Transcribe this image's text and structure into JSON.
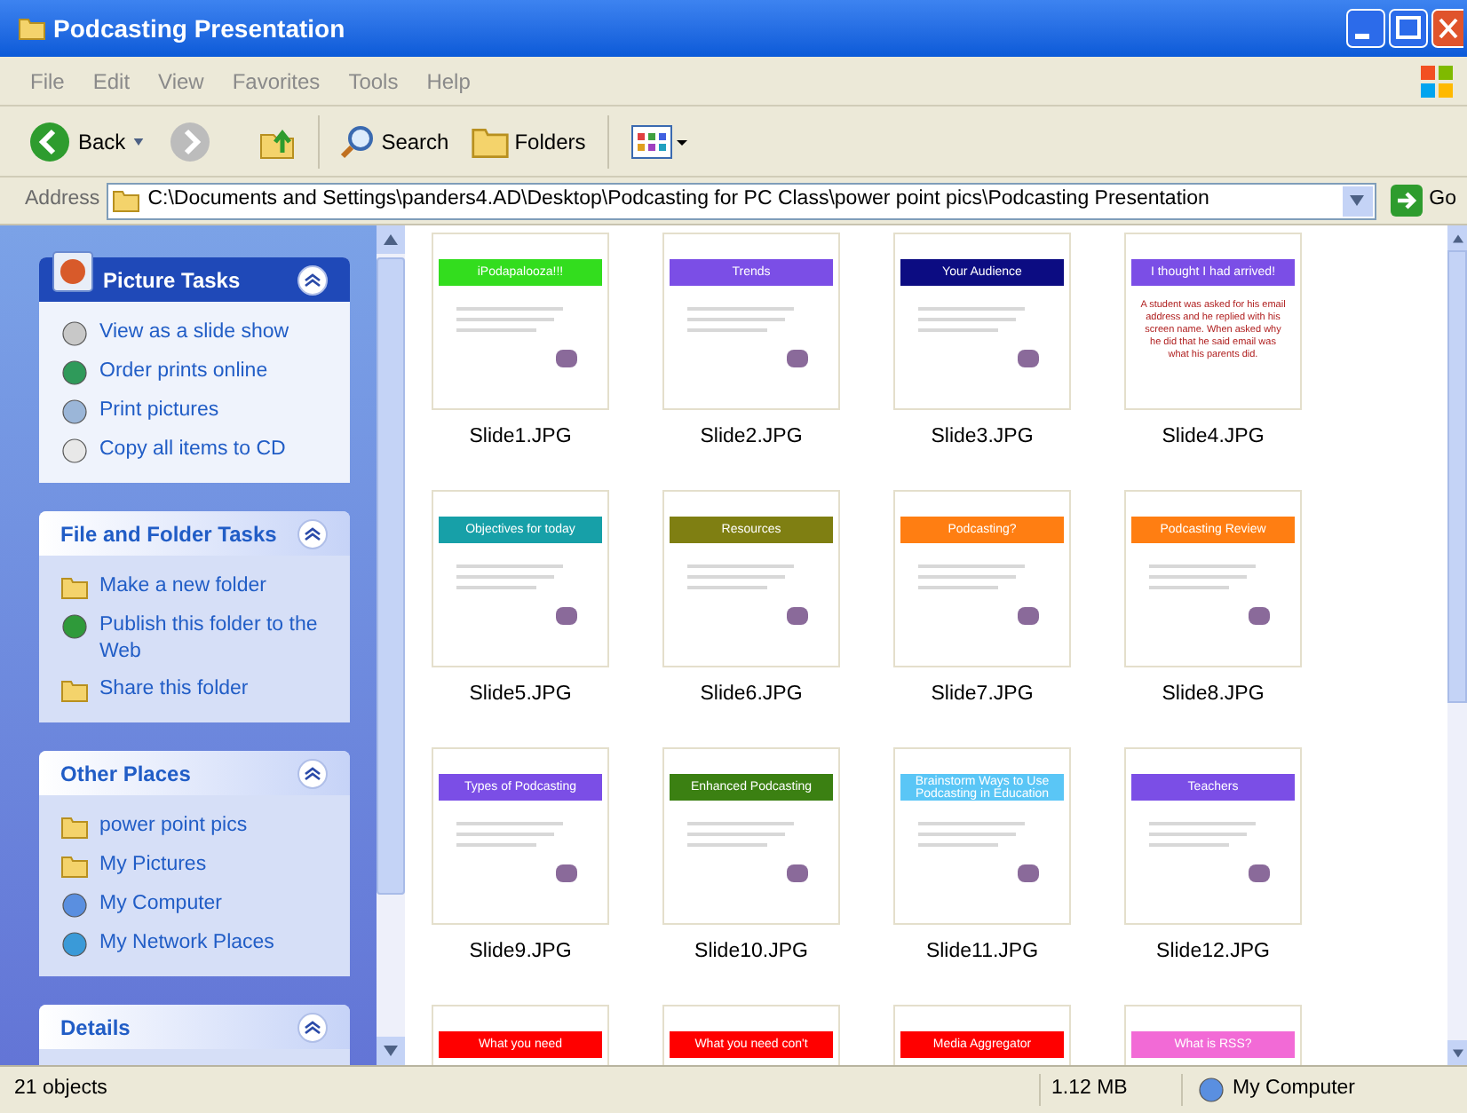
{
  "window": {
    "title": "Podcasting Presentation"
  },
  "menu": [
    "File",
    "Edit",
    "View",
    "Favorites",
    "Tools",
    "Help"
  ],
  "toolbar": {
    "back": "Back",
    "search": "Search",
    "folders": "Folders"
  },
  "address": {
    "label": "Address",
    "value": "C:\\Documents and Settings\\panders4.AD\\Desktop\\Podcasting for PC Class\\power point pics\\Podcasting Presentation",
    "go": "Go"
  },
  "task_panels": [
    {
      "title": "Picture Tasks",
      "kind": "special",
      "expanded": true,
      "items": [
        "View as a slide show",
        "Order prints online",
        "Print pictures",
        "Copy all items to CD"
      ]
    },
    {
      "title": "File and Folder Tasks",
      "kind": "normal",
      "expanded": true,
      "items": [
        "Make a new folder",
        "Publish this folder to the Web",
        "Share this folder"
      ]
    },
    {
      "title": "Other Places",
      "kind": "normal",
      "expanded": true,
      "items": [
        "power point pics",
        "My Pictures",
        "My Computer",
        "My Network Places"
      ]
    },
    {
      "title": "Details",
      "kind": "normal",
      "expanded": true
    }
  ],
  "files": [
    {
      "name": "Slide1.JPG",
      "slide_title": "iPodapalooza!!!",
      "color": "#33dd1e"
    },
    {
      "name": "Slide2.JPG",
      "slide_title": "Trends",
      "color": "#7b4ee6"
    },
    {
      "name": "Slide3.JPG",
      "slide_title": "Your Audience",
      "color": "#0c0c82"
    },
    {
      "name": "Slide4.JPG",
      "slide_title": "I thought I had arrived!",
      "color": "#7b4ee6",
      "slide_body": "A student was asked for his email address and he replied with his screen name.  When asked why he did that he said email was what his parents did."
    },
    {
      "name": "Slide5.JPG",
      "slide_title": "Objectives for today",
      "color": "#17a0a8"
    },
    {
      "name": "Slide6.JPG",
      "slide_title": "Resources",
      "color": "#7f7f12"
    },
    {
      "name": "Slide7.JPG",
      "slide_title": "Podcasting?",
      "color": "#ff7e12"
    },
    {
      "name": "Slide8.JPG",
      "slide_title": "Podcasting Review",
      "color": "#ff7e12"
    },
    {
      "name": "Slide9.JPG",
      "slide_title": "Types of Podcasting",
      "color": "#7b4ee6"
    },
    {
      "name": "Slide10.JPG",
      "slide_title": "Enhanced Podcasting",
      "color": "#3b8012"
    },
    {
      "name": "Slide11.JPG",
      "slide_title": "Brainstorm Ways to Use Podcasting in Education",
      "color": "#5ac6f6"
    },
    {
      "name": "Slide12.JPG",
      "slide_title": "Teachers",
      "color": "#7b4ee6"
    },
    {
      "slide_title": "What you need",
      "color": "#ff0000"
    },
    {
      "slide_title": "What you need con't",
      "color": "#ff0000"
    },
    {
      "slide_title": "Media Aggregator",
      "color": "#ff0000"
    },
    {
      "slide_title": "What is RSS?",
      "color": "#f26ad6"
    }
  ],
  "status_bar": {
    "objects": "21 objects",
    "size": "1.12 MB",
    "zone": "My Computer"
  }
}
